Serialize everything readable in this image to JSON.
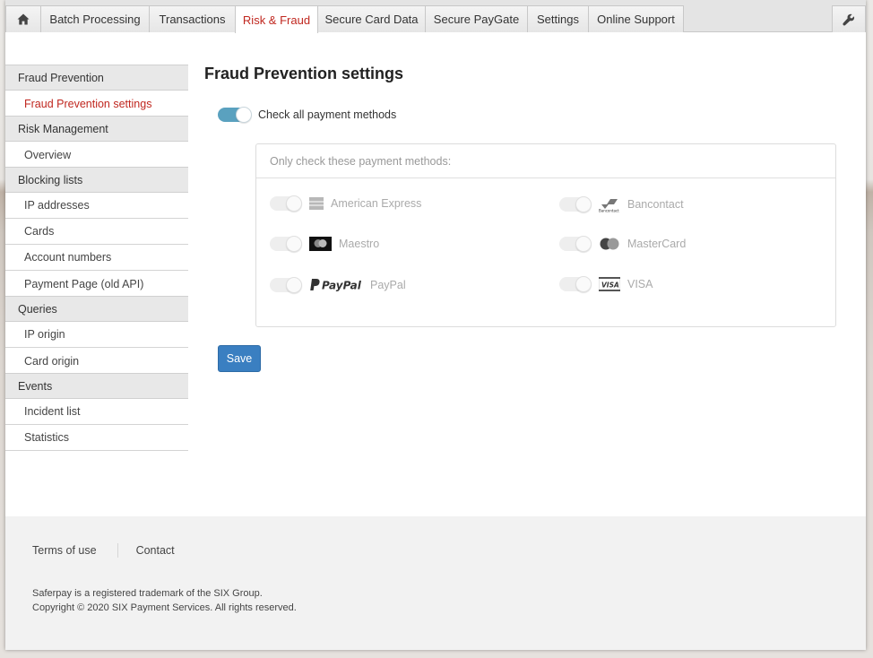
{
  "nav": {
    "home_icon": "home-icon",
    "tabs": [
      {
        "label": "Batch Processing"
      },
      {
        "label": "Transactions"
      },
      {
        "label": "Risk & Fraud"
      },
      {
        "label": "Secure Card Data"
      },
      {
        "label": "Secure PayGate"
      },
      {
        "label": "Settings"
      },
      {
        "label": "Online Support"
      }
    ],
    "active_tab": "Risk & Fraud",
    "tools_icon": "wrench-icon"
  },
  "sidebar": {
    "groups": [
      {
        "label": "Fraud Prevention",
        "items": [
          "Fraud Prevention settings"
        ]
      },
      {
        "label": "Risk Management",
        "items": [
          "Overview"
        ]
      },
      {
        "label": "Blocking lists",
        "items": [
          "IP addresses",
          "Cards",
          "Account numbers",
          "Payment Page (old API)"
        ]
      },
      {
        "label": "Queries",
        "items": [
          "IP origin",
          "Card origin"
        ]
      },
      {
        "label": "Events",
        "items": [
          "Incident list",
          "Statistics"
        ]
      }
    ],
    "active_item": "Fraud Prevention settings"
  },
  "main": {
    "title": "Fraud Prevention settings",
    "check_all_label": "Check all payment methods",
    "check_all_on": true,
    "panel_header": "Only check these payment methods:",
    "methods": [
      {
        "label": "American Express",
        "icon": "amex-card-icon",
        "enabled": false
      },
      {
        "label": "Bancontact",
        "icon": "bancontact-logo-icon",
        "enabled": false
      },
      {
        "label": "Maestro",
        "icon": "maestro-logo-icon",
        "enabled": false
      },
      {
        "label": "MasterCard",
        "icon": "mastercard-logo-icon",
        "enabled": false
      },
      {
        "label": "PayPal",
        "icon": "paypal-logo-icon",
        "enabled": false
      },
      {
        "label": "VISA",
        "icon": "visa-logo-icon",
        "enabled": false
      }
    ],
    "save_label": "Save"
  },
  "footer": {
    "terms_label": "Terms of use",
    "contact_label": "Contact",
    "trademark": "Saferpay is a registered trademark of the SIX Group.",
    "copyright": "Copyright © 2020 SIX Payment Services. All rights reserved."
  },
  "colors": {
    "accent_red": "#c0271f",
    "toggle_on": "#5aa1bf",
    "save_button": "#3a7fc1"
  }
}
